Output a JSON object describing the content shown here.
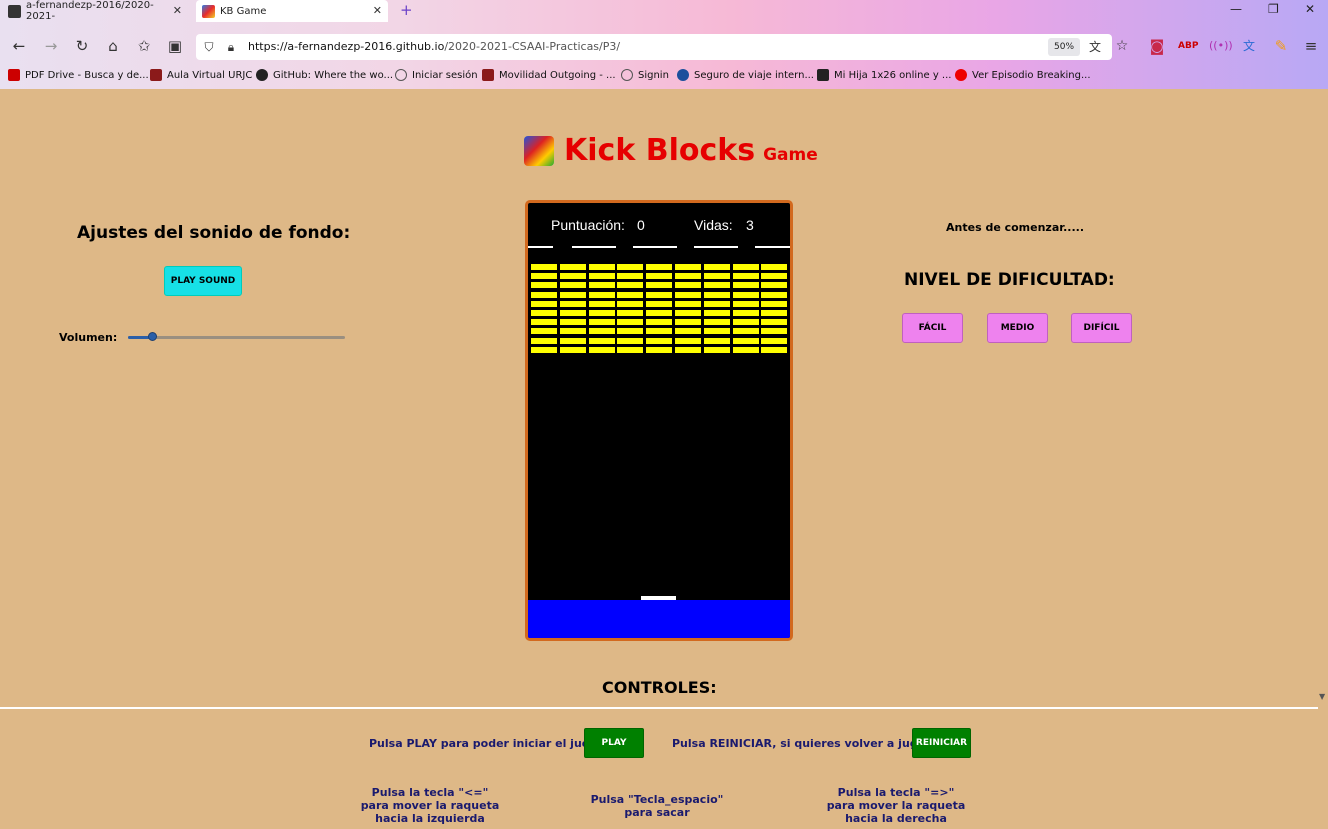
{
  "browser": {
    "tabs": [
      {
        "title": "a-fernandezp-2016/2020-2021-",
        "active": false
      },
      {
        "title": "KB Game",
        "active": true
      }
    ],
    "url_host": "https://a-fernandezp-2016.github.io",
    "url_path": "/2020-2021-CSAAI-Practicas/P3/",
    "zoom": "50%",
    "bookmarks": [
      "PDF Drive - Busca y de...",
      "Aula Virtual URJC",
      "GitHub: Where the wo...",
      "Iniciar sesión",
      "Movilidad Outgoing - ...",
      "Signin",
      "Seguro de viaje intern...",
      "Mi Hija 1x26 online y ...",
      "Ver Episodio Breaking..."
    ]
  },
  "header": {
    "title": "Kick Blocks",
    "subtitle": "Game"
  },
  "sound": {
    "heading": "Ajustes del sonido de fondo:",
    "play_label": "PLAY SOUND",
    "volume_label": "Volumen:",
    "volume_fraction": 0.11
  },
  "game": {
    "score_label": "Puntuación:",
    "score": "0",
    "lives_label": "Vidas:",
    "lives": "3",
    "brick_rows": 10,
    "brick_cols": 9,
    "brick_color": "#ffff00",
    "ground_color": "#0000ff"
  },
  "difficulty": {
    "intro": "Antes de comenzar.....",
    "heading": "NIVEL DE DIFICULTAD:",
    "levels": [
      "FÁCIL",
      "MEDIO",
      "DIFÍCIL"
    ]
  },
  "controls": {
    "heading": "CONTROLES:",
    "play_text": "Pulsa PLAY para poder iniciar el juego:",
    "play_button": "PLAY",
    "restart_text": "Pulsa REINICIAR, si quieres volver a jugar:",
    "restart_button": "REINICIAR",
    "hint_left": [
      "Pulsa la tecla \"<=\"",
      "para mover la raqueta",
      "hacia la izquierda"
    ],
    "hint_space": [
      "Pulsa \"Tecla_espacio\"",
      "para sacar"
    ],
    "hint_right": [
      "Pulsa la tecla \"=>\"",
      "para mover la raqueta",
      "hacia la derecha"
    ]
  }
}
